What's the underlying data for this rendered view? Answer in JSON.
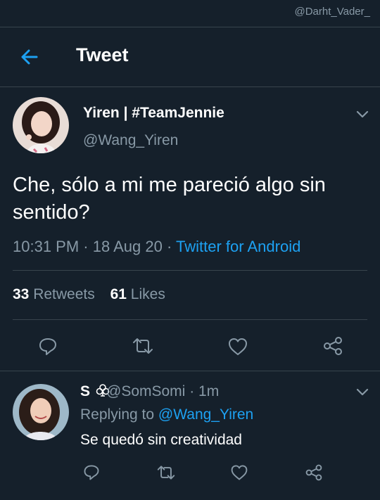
{
  "watermark": "@Darht_Vader_",
  "header": {
    "title": "Tweet",
    "back_icon": "arrow-left-icon"
  },
  "tweet": {
    "display_name": "Yiren | #TeamJennie",
    "handle": "@Wang_Yiren",
    "text": "Che, sólo a mi me pareció algo sin sentido?",
    "time": "10:31 PM",
    "date": "18 Aug 20",
    "sep1": "·",
    "sep2": "·",
    "source": "Twitter for Android",
    "retweets_count": "33",
    "retweets_label": "Retweets",
    "likes_count": "61",
    "likes_label": "Likes"
  },
  "reply": {
    "display_name": "S",
    "name_icon": "club-suit-icon",
    "handle": "@SomSomi",
    "sep": "·",
    "time": "1m",
    "replying_label": "Replying to",
    "replying_to": "@Wang_Yiren",
    "text": "Se quedó sin creatividad"
  },
  "colors": {
    "background": "#15202b",
    "border": "#38444d",
    "secondary_text": "#8899a6",
    "accent": "#1da1f2"
  }
}
